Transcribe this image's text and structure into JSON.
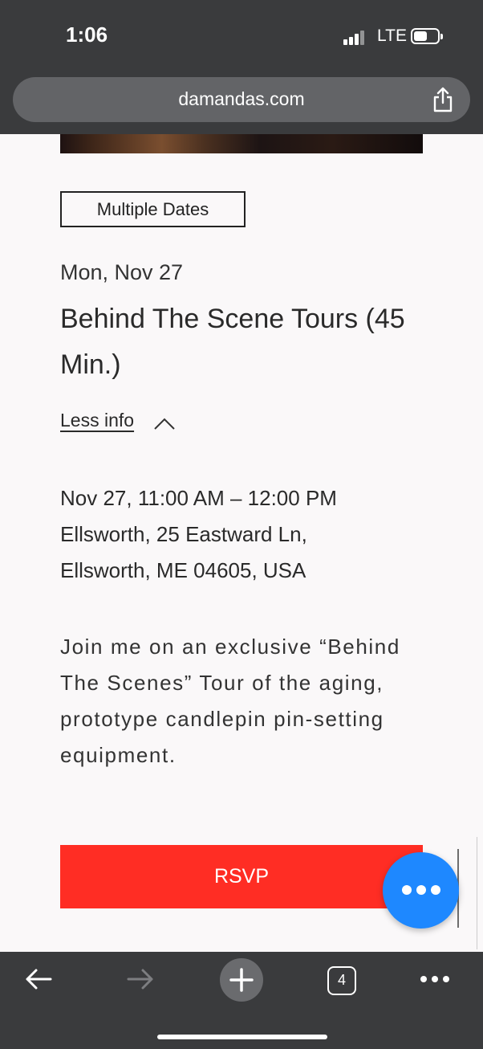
{
  "status_bar": {
    "time": "1:06",
    "network": "LTE"
  },
  "browser": {
    "url": "damandas.com",
    "open_tab_count": "4"
  },
  "event": {
    "badge": "Multiple Dates",
    "date_short": "Mon, Nov 27",
    "title": "Behind The Scene Tours (45 Min.)",
    "less_info_label": "Less info",
    "datetime": "Nov 27, 11:00 AM – 12:00 PM",
    "address_line1": "Ellsworth, 25 Eastward Ln,",
    "address_line2": "Ellsworth, ME 04605, USA",
    "description": "Join me on an exclusive “Behind The Scenes” Tour of the aging, prototype candlepin pin-setting equipment.",
    "rsvp_label": "RSVP"
  },
  "colors": {
    "rsvp_red": "#ff2d24",
    "chat_blue": "#1e88ff",
    "chrome_dark": "#3a3b3d",
    "page_bg": "#faf8f9"
  },
  "icons": {
    "share": "share-icon",
    "chevron": "chevron-up-icon",
    "chat": "chat-ellipsis-icon",
    "back": "arrow-left-icon",
    "forward": "arrow-right-icon",
    "new_tab": "plus-icon",
    "more": "more-horizontal-icon"
  }
}
